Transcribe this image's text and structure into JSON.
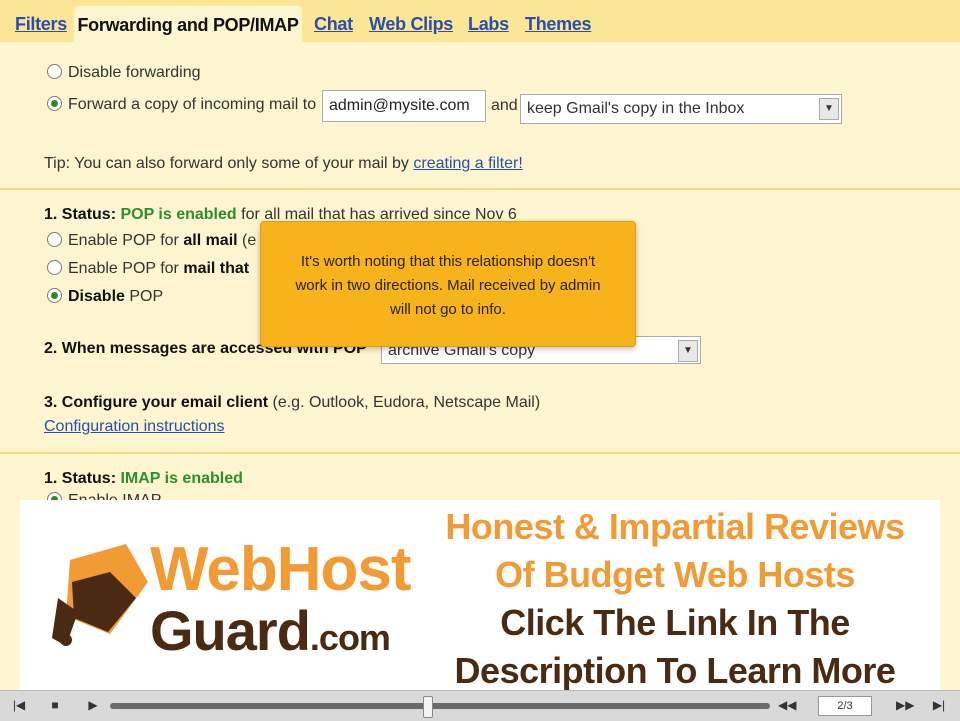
{
  "tabs": {
    "filters": "Filters",
    "forwarding": "Forwarding and POP/IMAP",
    "chat": "Chat",
    "webclips": "Web Clips",
    "labs": "Labs",
    "themes": "Themes"
  },
  "forwarding": {
    "disable_label": "Disable forwarding",
    "forward_label": "Forward a copy of incoming mail to",
    "forward_address": "admin@mysite.com",
    "and_label": "and",
    "copy_option": "keep Gmail's copy in the Inbox",
    "tip_prefix": "Tip: You can also forward only some of your mail by",
    "tip_link": "creating a filter!"
  },
  "pop": {
    "status_prefix": "1. Status:",
    "status_value": "POP is enabled",
    "status_suffix": "for all mail that has arrived since Nov 6",
    "opt_all_prefix": "Enable POP for",
    "opt_all_bold": "all mail",
    "opt_all_suffix": "(e",
    "opt_now_prefix": "Enable POP for",
    "opt_now_bold": "mail that",
    "opt_disable_bold": "Disable",
    "opt_disable_suffix": "POP",
    "when_label": "2. When messages are accessed with POP",
    "when_value": "archive Gmail's copy",
    "configure_bold": "3. Configure your email client",
    "configure_hint": "(e.g. Outlook, Eudora, Netscape Mail)",
    "config_link": "Configuration instructions"
  },
  "imap": {
    "status_prefix": "1. Status:",
    "status_value": "IMAP is enabled",
    "enable_label": "Enable IMAP"
  },
  "tooltip": {
    "text": "It's worth noting that this relationship doesn't work in two directions. Mail received by admin will not go to info."
  },
  "banner": {
    "logo_line1": "WebHost",
    "logo_line2": "Guard",
    "logo_com": ".com",
    "ad_line1": "Honest & Impartial Reviews",
    "ad_line2": "Of Budget Web Hosts",
    "ad_line3": "Click The Link In The",
    "ad_line4": "Description To Learn More",
    "orange": "#f29a34",
    "brown": "#4b2a14"
  },
  "player": {
    "page_indicator": "2/3",
    "progress": 0.48
  }
}
